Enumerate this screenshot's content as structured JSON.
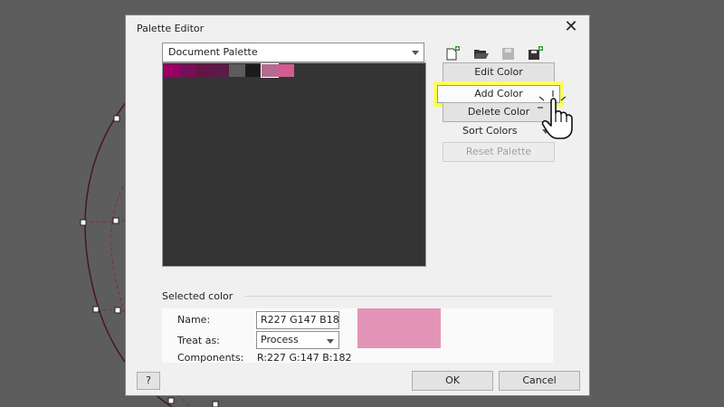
{
  "dialog": {
    "title": "Palette Editor",
    "close_glyph": "✕"
  },
  "palette_dropdown": {
    "selected": "Document Palette"
  },
  "swatches": [
    {
      "color": "#9a0064"
    },
    {
      "color": "#760f57"
    },
    {
      "color": "#651446"
    },
    {
      "color": "#5a1a4a"
    },
    {
      "color": "#5c5c5c"
    },
    {
      "color": "#1c1c1c"
    },
    {
      "color": "#b46a91",
      "selected": true
    },
    {
      "color": "#d05c92"
    }
  ],
  "toolbar": {
    "icons": [
      "new-palette-icon",
      "open-palette-icon",
      "save-palette-icon",
      "save-as-palette-icon"
    ]
  },
  "buttons": {
    "edit_color": "Edit Color",
    "add_color": "Add Color",
    "delete_color": "Delete Color",
    "sort_colors": "Sort Colors",
    "reset_palette": "Reset Palette"
  },
  "selected_color": {
    "section_label": "Selected color",
    "name_label": "Name:",
    "name_value": "R227 G147 B182",
    "treat_as_label": "Treat as:",
    "treat_as_value": "Process",
    "components_label": "Components:",
    "components_value": "R:227 G:147 B:182",
    "preview_color": "#e393b6"
  },
  "footer": {
    "help": "?",
    "ok": "OK",
    "cancel": "Cancel"
  },
  "colors": {
    "highlight": "#ffff55",
    "overlay": "#5d5d5d",
    "curve": "#4a1524"
  }
}
